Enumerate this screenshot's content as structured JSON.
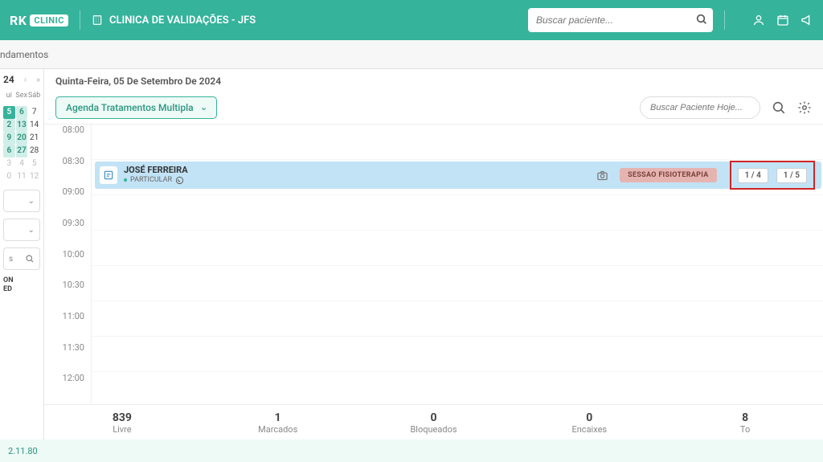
{
  "header": {
    "brand_prefix": "RK",
    "brand_tag": "CLINIC",
    "clinic_name": "CLINICA DE VALIDAÇÕES - JFS",
    "search_placeholder": "Buscar paciente..."
  },
  "subhead": {
    "tab_label": "ndamentos"
  },
  "mini_calendar": {
    "title": "24",
    "day_headers": [
      "ui",
      "Sex",
      "Sáb"
    ],
    "rows": [
      [
        "5",
        "6",
        "7"
      ],
      [
        "2",
        "13",
        "14"
      ],
      [
        "9",
        "20",
        "21"
      ],
      [
        "6",
        "27",
        "28"
      ],
      [
        "3",
        "4",
        "5"
      ],
      [
        "0",
        "11",
        "12"
      ]
    ],
    "highlight_map": {
      "sel": [
        [
          0,
          0
        ]
      ],
      "hl": [
        [
          0,
          1
        ],
        [
          1,
          0
        ],
        [
          1,
          1
        ],
        [
          2,
          0
        ],
        [
          2,
          1
        ],
        [
          3,
          0
        ],
        [
          3,
          1
        ]
      ],
      "muted": [
        [
          4,
          0
        ],
        [
          4,
          1
        ],
        [
          4,
          2
        ],
        [
          5,
          0
        ],
        [
          5,
          1
        ],
        [
          5,
          2
        ]
      ]
    },
    "tiny_search_label": "s",
    "side_label_line1": "ON",
    "side_label_line2": "ED"
  },
  "content": {
    "date_label": "Quinta-Feira, 05 De Setembro De 2024",
    "agenda_label": "Agenda Tratamentos Multipla",
    "search_today_placeholder": "Buscar Paciente Hoje...",
    "time_slots": [
      "08:00",
      "08:30",
      "09:00",
      "09:30",
      "10:00",
      "10:30",
      "11:00",
      "11:30",
      "12:00"
    ]
  },
  "appointment": {
    "name": "JOSÉ FERREIRA",
    "subtitle": "PARTICULAR",
    "tag": "SESSAO FISIOTERAPIA",
    "pill1": "1 / 4",
    "pill2": "1 / 5"
  },
  "stats": [
    {
      "num": "839",
      "label": "Livre"
    },
    {
      "num": "1",
      "label": "Marcados"
    },
    {
      "num": "0",
      "label": "Bloqueados"
    },
    {
      "num": "0",
      "label": "Encaixes"
    },
    {
      "num": "8",
      "label": "To"
    }
  ],
  "version": "2.11.80"
}
